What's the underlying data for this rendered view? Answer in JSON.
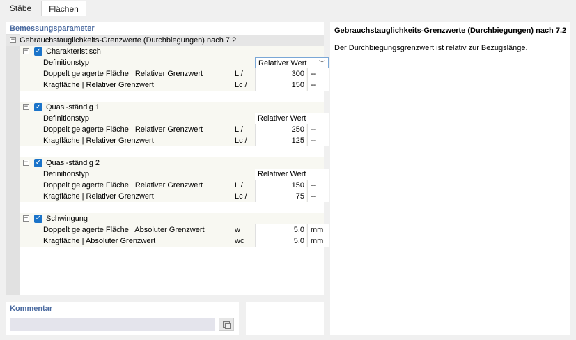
{
  "tabs": [
    {
      "label": "Stäbe"
    },
    {
      "label": "Flächen"
    }
  ],
  "left_panel": {
    "title": "Bemessungsparameter",
    "root_label": "Gebrauchstauglichkeits-Grenzwerte (Durchbiegungen) nach 7.2",
    "groups": [
      {
        "label": "Charakteristisch",
        "checked": true,
        "definitionstyp_label": "Definitionstyp",
        "definitionstyp_value": "Relativer Wert",
        "rows": [
          {
            "label": "Doppelt gelagerte Fläche | Relativer Grenzwert",
            "symbol": "L /",
            "value": "300",
            "unit": "--"
          },
          {
            "label": "Kragfläche | Relativer Grenzwert",
            "symbol": "Lc /",
            "value": "150",
            "unit": "--"
          }
        ]
      },
      {
        "label": "Quasi-ständig 1",
        "checked": true,
        "definitionstyp_label": "Definitionstyp",
        "definitionstyp_value": "Relativer Wert",
        "rows": [
          {
            "label": "Doppelt gelagerte Fläche | Relativer Grenzwert",
            "symbol": "L /",
            "value": "250",
            "unit": "--"
          },
          {
            "label": "Kragfläche | Relativer Grenzwert",
            "symbol": "Lc /",
            "value": "125",
            "unit": "--"
          }
        ]
      },
      {
        "label": "Quasi-ständig 2",
        "checked": true,
        "definitionstyp_label": "Definitionstyp",
        "definitionstyp_value": "Relativer Wert",
        "rows": [
          {
            "label": "Doppelt gelagerte Fläche | Relativer Grenzwert",
            "symbol": "L /",
            "value": "150",
            "unit": "--"
          },
          {
            "label": "Kragfläche | Relativer Grenzwert",
            "symbol": "Lc /",
            "value": "75",
            "unit": "--"
          }
        ]
      },
      {
        "label": "Schwingung",
        "checked": true,
        "rows": [
          {
            "label": "Doppelt gelagerte Fläche | Absoluter Grenzwert",
            "symbol": "w",
            "value": "5.0",
            "unit": "mm"
          },
          {
            "label": "Kragfläche | Absoluter Grenzwert",
            "symbol": "wc",
            "value": "5.0",
            "unit": "mm"
          }
        ]
      }
    ]
  },
  "comment": {
    "title": "Kommentar",
    "value": ""
  },
  "info_panel": {
    "heading": "Gebrauchstauglichkeits-Grenzwerte (Durchbiegungen) nach 7.2",
    "description": "Der Durchbiegungsgrenzwert ist relativ zur Bezugslänge."
  },
  "icons": {
    "expand": "minus-box-icon",
    "checkbox": "checkmark-icon",
    "dropdown": "chevron-down-icon",
    "comment_button": "copy-icon"
  },
  "colors": {
    "section_title": "#4a6aa0",
    "checkbox": "#1a73c9",
    "row_bg": "#f8f8f2"
  }
}
